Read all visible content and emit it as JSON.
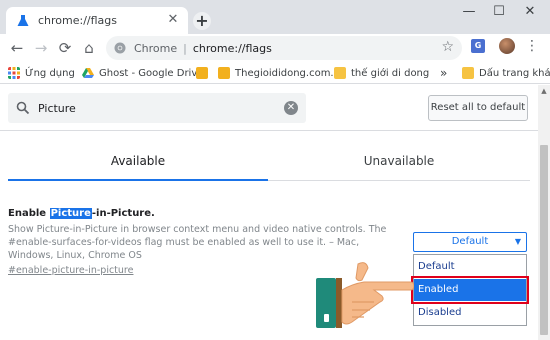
{
  "browser": {
    "tab_title": "chrome://flags",
    "new_tab_symbol": "+",
    "window_controls": [
      "—",
      "☐",
      "✕"
    ],
    "nav": {
      "back": "←",
      "forward": "→",
      "reload": "⟳",
      "home": "⌂"
    },
    "omnibox": {
      "origin": "Chrome",
      "separator": "|",
      "url": "chrome://flags"
    },
    "extension_label": "G"
  },
  "bookmarks": [
    {
      "label": "Ứng dụng",
      "icon": "apps-grid-icon",
      "color": "#e8453c"
    },
    {
      "label": "Ghost - Google Drive",
      "icon": "google-drive-icon",
      "color": "#1ea362"
    },
    {
      "label": "",
      "icon": "runner-icon",
      "color": "#f2b01e"
    },
    {
      "label": "Thegioididong.com...",
      "icon": "runner-icon",
      "color": "#f2b01e"
    },
    {
      "label": "thế giới di dong",
      "icon": "folder-icon",
      "color": "#f6c342"
    },
    {
      "label": "»",
      "icon": "chevron-icon",
      "color": "#5f6368"
    },
    {
      "label": "Dấu trang khác",
      "icon": "folder-icon",
      "color": "#f6c342"
    }
  ],
  "flags": {
    "search": {
      "value": "Picture",
      "clear": "✕"
    },
    "reset_label": "Reset all to default",
    "tabs": [
      {
        "label": "Available"
      },
      {
        "label": "Unavailable"
      }
    ],
    "flag": {
      "title_prefix": "Enable ",
      "title_highlight": "Picture",
      "title_suffix": "-in-Picture.",
      "description": "Show Picture-in-Picture in browser context menu and video native controls. The #enable-surfaces-for-videos flag must be enabled as well to use it. – Mac, Windows, Linux, Chrome OS",
      "link": "#enable-picture-in-picture"
    },
    "select": {
      "value": "Default",
      "caret": "▼",
      "options": [
        "Default",
        "Enabled",
        "Disabled"
      ],
      "highlighted": "Enabled"
    }
  },
  "colors": {
    "accent": "#1a73e8",
    "highlight_border": "#e0001b"
  }
}
